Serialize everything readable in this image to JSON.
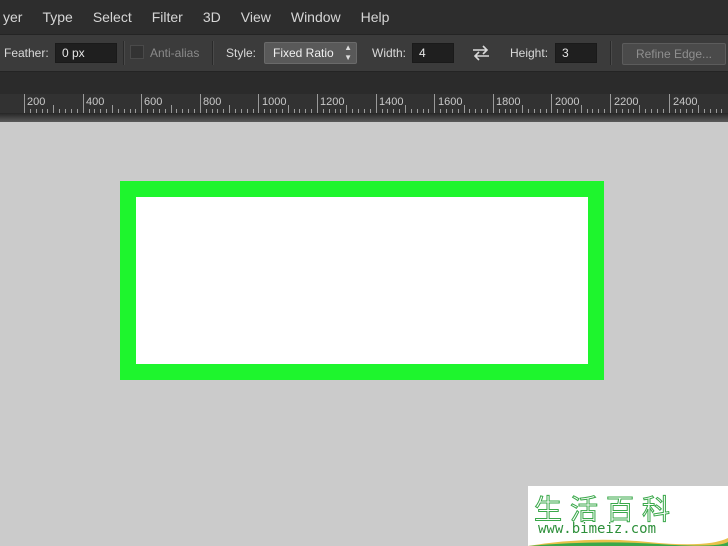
{
  "menubar": {
    "items": [
      "yer",
      "Type",
      "Select",
      "Filter",
      "3D",
      "View",
      "Window",
      "Help"
    ]
  },
  "options": {
    "feather_label": "Feather:",
    "feather_value": "0 px",
    "antialias_label": "Anti-alias",
    "style_label": "Style:",
    "style_value": "Fixed Ratio",
    "width_label": "Width:",
    "width_value": "4",
    "height_label": "Height:",
    "height_value": "3",
    "refine_label": "Refine Edge..."
  },
  "ruler": {
    "labels": [
      "200",
      "400",
      "600",
      "800",
      "1000",
      "1200",
      "1400",
      "1600",
      "1800",
      "2000",
      "2200",
      "2400"
    ]
  },
  "canvas": {
    "selection_color": "#1ef52d",
    "fill_color": "#ffffff"
  },
  "watermark": {
    "title": "生活百科",
    "url": "www.bimeiz.com"
  }
}
